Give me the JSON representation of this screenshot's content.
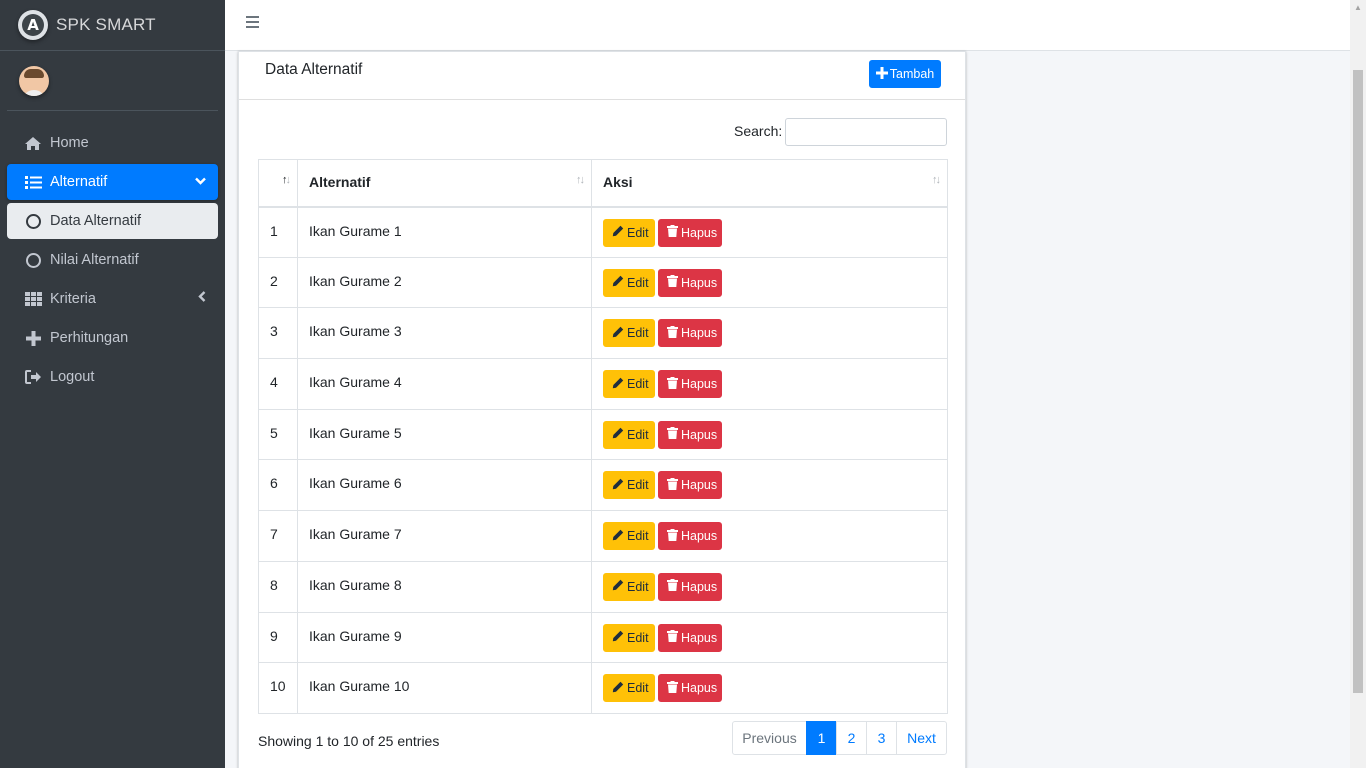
{
  "brand": {
    "name": "SPK SMART",
    "logo_letter": "A"
  },
  "sidebar": {
    "items": [
      {
        "label": "Home",
        "icon": "home-icon"
      },
      {
        "label": "Alternatif",
        "icon": "list-icon"
      },
      {
        "label": "Data Alternatif",
        "icon": "circle-icon"
      },
      {
        "label": "Nilai Alternatif",
        "icon": "circle-icon"
      },
      {
        "label": "Kriteria",
        "icon": "table-grid-icon"
      },
      {
        "label": "Perhitungan",
        "icon": "plus-icon"
      },
      {
        "label": "Logout",
        "icon": "sign-out-icon"
      }
    ]
  },
  "card": {
    "title": "Data Alternatif",
    "add_label": "Tambah",
    "search_label": "Search:",
    "search_value": ""
  },
  "table": {
    "headers": [
      "",
      "Alternatif",
      "Aksi"
    ],
    "edit_label": "Edit",
    "delete_label": "Hapus",
    "rows": [
      {
        "no": "1",
        "name": "Ikan Gurame 1"
      },
      {
        "no": "2",
        "name": "Ikan Gurame 2"
      },
      {
        "no": "3",
        "name": "Ikan Gurame 3"
      },
      {
        "no": "4",
        "name": "Ikan Gurame 4"
      },
      {
        "no": "5",
        "name": "Ikan Gurame 5"
      },
      {
        "no": "6",
        "name": "Ikan Gurame 6"
      },
      {
        "no": "7",
        "name": "Ikan Gurame 7"
      },
      {
        "no": "8",
        "name": "Ikan Gurame 8"
      },
      {
        "no": "9",
        "name": "Ikan Gurame 9"
      },
      {
        "no": "10",
        "name": "Ikan Gurame 10"
      }
    ]
  },
  "pagination": {
    "info": "Showing 1 to 10 of 25 entries",
    "previous": "Previous",
    "pages": [
      "1",
      "2",
      "3"
    ],
    "current": "1",
    "next": "Next"
  },
  "colors": {
    "primary": "#007bff",
    "warning": "#ffc107",
    "danger": "#dc3545",
    "sidebar": "#343a40"
  }
}
